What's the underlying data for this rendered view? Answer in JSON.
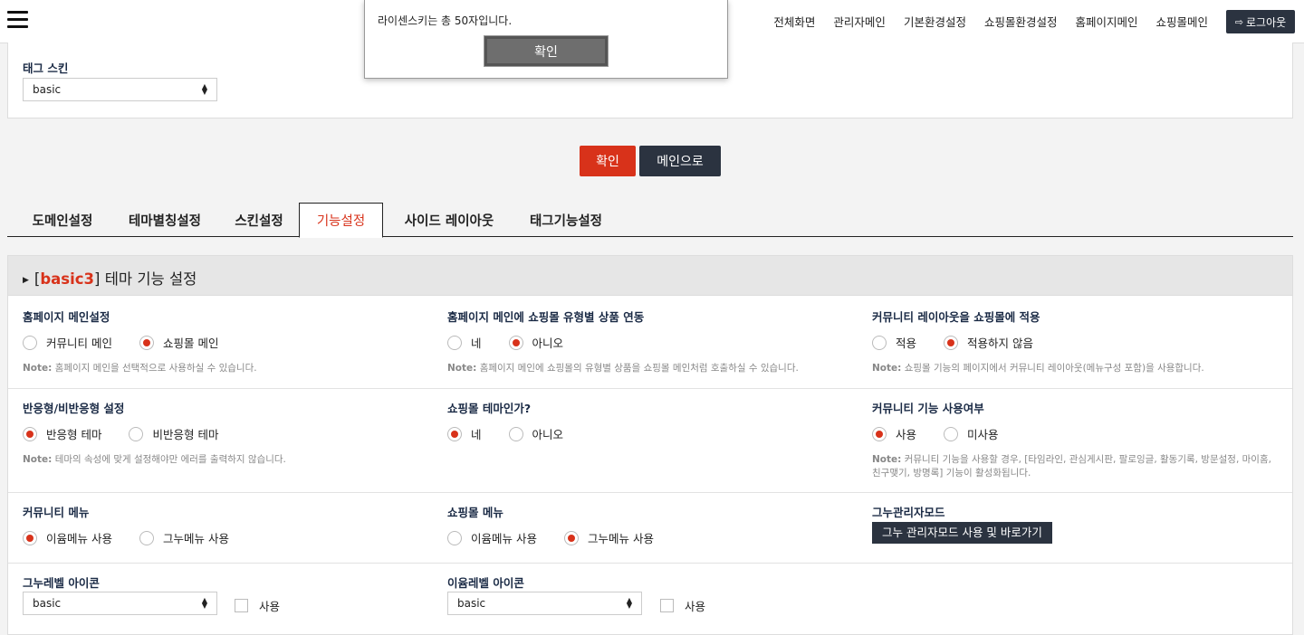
{
  "topbar": {
    "nav": [
      "전체화면",
      "관리자메인",
      "기본환경설정",
      "쇼핑몰환경설정",
      "홈페이지메인",
      "쇼핑몰메인"
    ],
    "logout_label": "로그아웃"
  },
  "dialog": {
    "message": "라이센스키는 총 50자입니다.",
    "ok_label": "확인"
  },
  "tag_skin": {
    "label": "태그 스킨",
    "value": "basic"
  },
  "actions": {
    "confirm_label": "확인",
    "main_label": "메인으로"
  },
  "tabs": [
    {
      "label": "도메인설정",
      "active": false
    },
    {
      "label": "테마별칭설정",
      "active": false
    },
    {
      "label": "스킨설정",
      "active": false
    },
    {
      "label": "기능설정",
      "active": true
    },
    {
      "label": "사이드 레이아웃",
      "active": false
    },
    {
      "label": "태그기능설정",
      "active": false
    }
  ],
  "section": {
    "title_open": "[",
    "title_theme": "basic3",
    "title_close": "] 테마 기능 설정"
  },
  "fields": {
    "home_main": {
      "label": "홈페이지 메인설정",
      "options": [
        "커뮤니티 메인",
        "쇼핑몰 메인"
      ],
      "selected": "쇼핑몰 메인",
      "note_prefix": "Note:",
      "note": "홈페이지 메인을 선택적으로 사용하실 수 있습니다."
    },
    "home_shop_link": {
      "label": "홈페이지 메인에 쇼핑몰 유형별 상품 연동",
      "options": [
        "네",
        "아니오"
      ],
      "selected": "아니오",
      "note_prefix": "Note:",
      "note": "홈페이지 메인에 쇼핑몰의 유형별 상품을 쇼핑몰 메인처럼 호출하실 수 있습니다."
    },
    "community_layout": {
      "label": "커뮤니티 레이아웃을 쇼핑몰에 적용",
      "options": [
        "적용",
        "적용하지 않음"
      ],
      "selected": "적용하지 않음",
      "note_prefix": "Note:",
      "note": "쇼핑몰 기능의 페이지에서 커뮤니티 레이아웃(메뉴구성 포함)을 사용합니다."
    },
    "responsive": {
      "label": "반응형/비반응형 설정",
      "options": [
        "반응형 테마",
        "비반응형 테마"
      ],
      "selected": "반응형 테마",
      "note_prefix": "Note:",
      "note": "테마의 속성에 맞게 설정해야만 에러를 출력하지 않습니다."
    },
    "shop_theme": {
      "label": "쇼핑몰 테마인가?",
      "options": [
        "네",
        "아니오"
      ],
      "selected": "네"
    },
    "community_use": {
      "label": "커뮤니티 기능 사용여부",
      "options": [
        "사용",
        "미사용"
      ],
      "selected": "사용",
      "note_prefix": "Note:",
      "note": "커뮤니티 기능을 사용할 경우, [타임라인, 관심게시판, 팔로잉글, 활동기록, 방문설정, 마이홈, 친구맺기, 방명록] 기능이 활성화됩니다."
    },
    "community_menu": {
      "label": "커뮤니티 메뉴",
      "options": [
        "이윰메뉴 사용",
        "그누메뉴 사용"
      ],
      "selected": "이윰메뉴 사용"
    },
    "shop_menu": {
      "label": "쇼핑몰 메뉴",
      "options": [
        "이윰메뉴 사용",
        "그누메뉴 사용"
      ],
      "selected": "그누메뉴 사용"
    },
    "gnu_admin": {
      "label": "그누관리자모드",
      "button_label": "그누 관리자모드 사용 및 바로가기"
    },
    "gnu_level_icon": {
      "label": "그누레벨 아이콘",
      "value": "basic",
      "checkbox_label": "사용"
    },
    "eyoom_level_icon": {
      "label": "이윰레벨 아이콘",
      "value": "basic",
      "checkbox_label": "사용"
    }
  },
  "colors": {
    "accent": "#d8321a",
    "dark": "#2b3340",
    "label": "#1a2a45"
  }
}
